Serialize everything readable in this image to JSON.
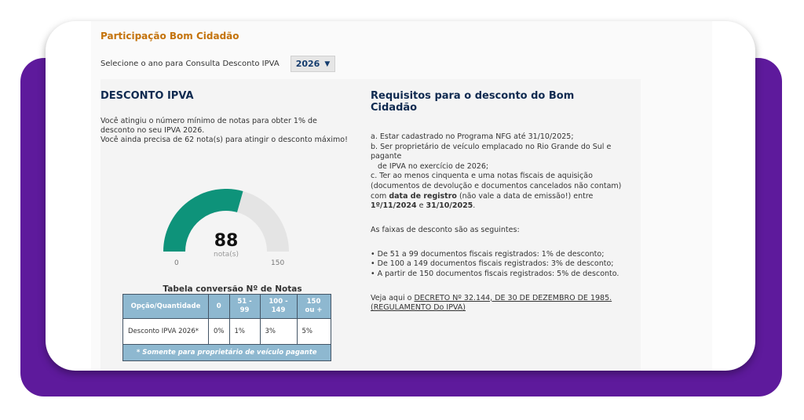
{
  "header": {
    "title": "Participação Bom Cidadão",
    "year_prompt": "Selecione o ano para Consulta Desconto IPVA",
    "year_selected": "2026"
  },
  "discount": {
    "title": "DESCONTO IPVA",
    "line1": "Você atingiu o número mínimo de notas para obter 1% de desconto no seu IPVA 2026.",
    "line2": "Você ainda precisa de 62 nota(s) para atingir o desconto máximo!"
  },
  "gauge": {
    "value": "88",
    "unit": "nota(s)",
    "min": "0",
    "max": "150",
    "fraction": 0.5867,
    "fill_color": "#0e937a",
    "track_color": "#e4e4e4"
  },
  "table": {
    "title": "Tabela conversão Nº de Notas",
    "headers": [
      "Opção/Quantidade",
      "0",
      "51 - 99",
      "100 - 149",
      "150 ou +"
    ],
    "row": [
      "Desconto IPVA 2026*",
      "0%",
      "1%",
      "3%",
      "5%"
    ],
    "footnote": "* Somente para proprietário de veículo pagante"
  },
  "requirements": {
    "title": "Requisitos para o desconto do Bom Cidadão",
    "a": "a. Estar cadastrado no Programa NFG até 31/10/2025;",
    "b1": "b. Ser proprietário de veículo emplacado no Rio Grande do Sul e pagante",
    "b2": "de IPVA no exercício de 2026;",
    "c_pre": "c. Ter ao menos cinquenta e uma notas fiscais de aquisição (documentos de devolução e documentos cancelados não contam) com ",
    "c_bold1": "data de registro",
    "c_mid": " (não vale a data de emissão!) entre ",
    "c_bold2": "1º/11/2024",
    "c_and": " e ",
    "c_bold3": "31/10/2025",
    "c_end": ".",
    "faixas": "As faixas de desconto são as seguintes:",
    "bullet1": "• De 51 a 99 documentos fiscais registrados: 1% de desconto;",
    "bullet2": "• De 100 a 149 documentos fiscais registrados: 3% de desconto;",
    "bullet3": "• A partir de 150 documentos fiscais registrados: 5% de desconto.",
    "veja_pre": "Veja aqui o ",
    "link1": "DECRETO Nº 32.144, DE 30 DE DEZEMBRO DE 1985.",
    "link2": "(REGULAMENTO Do IPVA)"
  }
}
